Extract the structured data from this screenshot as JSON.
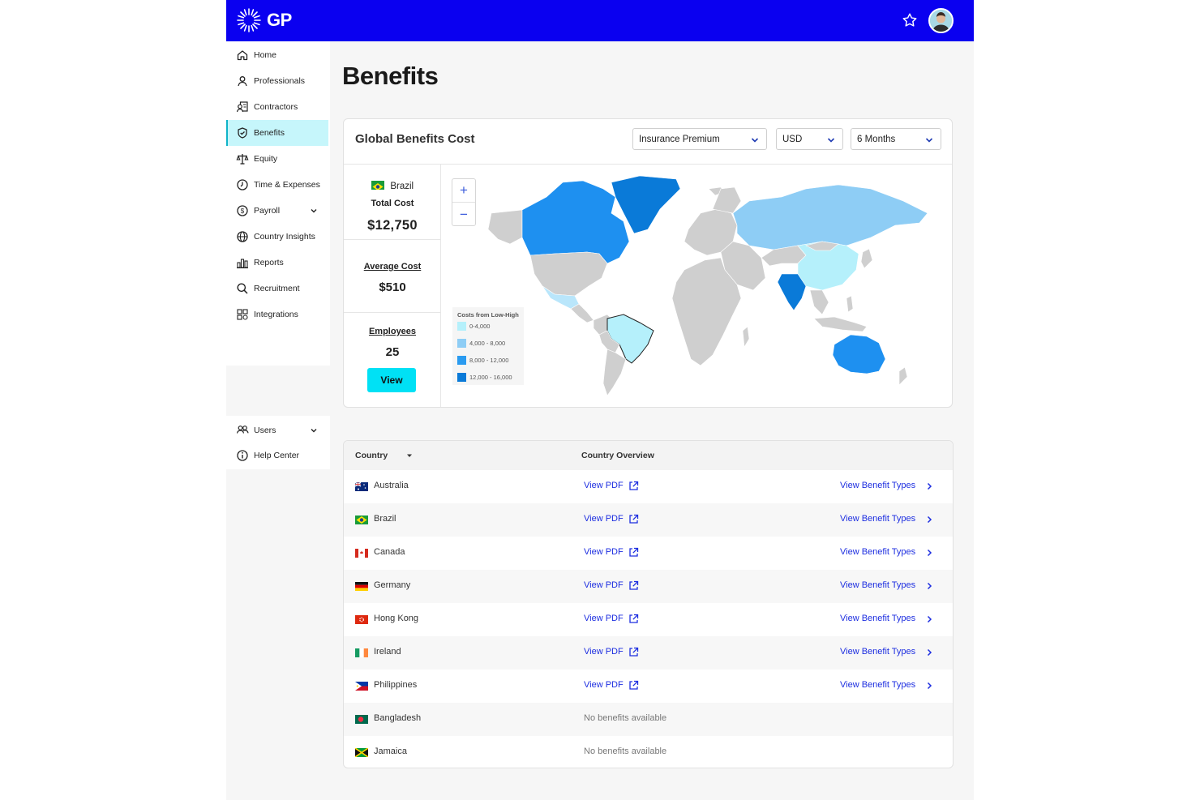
{
  "app": {
    "logo_text": "GP"
  },
  "sidebar": {
    "items": [
      {
        "label": "Home",
        "icon": "home-icon"
      },
      {
        "label": "Professionals",
        "icon": "person-icon"
      },
      {
        "label": "Contractors",
        "icon": "contractor-icon"
      },
      {
        "label": "Benefits",
        "icon": "shield-icon",
        "active": true
      },
      {
        "label": "Equity",
        "icon": "scale-icon"
      },
      {
        "label": "Time & Expenses",
        "icon": "clock-icon"
      },
      {
        "label": "Payroll",
        "icon": "dollar-icon",
        "expandable": true
      },
      {
        "label": "Country Insights",
        "icon": "globe-icon"
      },
      {
        "label": "Reports",
        "icon": "bar-chart-icon"
      },
      {
        "label": "Recruitment",
        "icon": "search-icon"
      },
      {
        "label": "Integrations",
        "icon": "integrations-icon"
      }
    ],
    "bottom_items": [
      {
        "label": "Users",
        "icon": "users-icon",
        "expandable": true
      },
      {
        "label": "Help Center",
        "icon": "info-icon"
      }
    ]
  },
  "page": {
    "title": "Benefits"
  },
  "card": {
    "title": "Global Benefits Cost",
    "filters": {
      "type": "Insurance Premium",
      "currency": "USD",
      "period": "6 Months"
    },
    "selected_country": "Brazil",
    "total_cost_label": "Total Cost",
    "total_cost": "$12,750",
    "average_cost_label": "Average Cost",
    "average_cost": "$510",
    "employees_label": "Employees",
    "employees": "25",
    "view_button": "View",
    "zoom_in": "+",
    "zoom_out": "−",
    "legend": {
      "title": "Costs from Low-High",
      "ranges": [
        {
          "label": "0-4,000",
          "color": "#b5f0fb"
        },
        {
          "label": "4,000 - 8,000",
          "color": "#8ecdf5"
        },
        {
          "label": "8,000 - 12,000",
          "color": "#2a9bf0"
        },
        {
          "label": "12,000 - 16,000",
          "color": "#0a7ad8"
        }
      ]
    }
  },
  "table": {
    "col_country": "Country",
    "col_overview": "Country Overview",
    "view_pdf": "View PDF",
    "view_benefit_types": "View Benefit Types",
    "no_benefits": "No benefits available",
    "rows": [
      {
        "country": "Australia",
        "has_benefits": true
      },
      {
        "country": "Brazil",
        "has_benefits": true
      },
      {
        "country": "Canada",
        "has_benefits": true
      },
      {
        "country": "Germany",
        "has_benefits": true
      },
      {
        "country": "Hong Kong",
        "has_benefits": true
      },
      {
        "country": "Ireland",
        "has_benefits": true
      },
      {
        "country": "Philippines",
        "has_benefits": true
      },
      {
        "country": "Bangladesh",
        "has_benefits": false
      },
      {
        "country": "Jamaica",
        "has_benefits": false
      }
    ]
  },
  "colors": {
    "brand": "#0a00f0",
    "accent": "#00e1f5",
    "link": "#1d2ee0",
    "active_nav": "#c6f6fb"
  }
}
